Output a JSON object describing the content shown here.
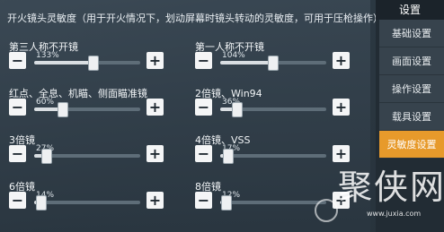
{
  "header": {
    "text": "开火镜头灵敏度（用于开火情况下，划动屏幕时镜头转动的灵敏度，可用于压枪操作）"
  },
  "settings": [
    {
      "label": "第三人称不开镜",
      "percent": "133%",
      "fraction": 0.55
    },
    {
      "label": "第一人称不开镜",
      "percent": "104%",
      "fraction": 0.49
    },
    {
      "label": "红点、全息、机瞄、侧面瞄准镜",
      "percent": "60%",
      "fraction": 0.26
    },
    {
      "label": "2倍镜、Win94",
      "percent": "36%",
      "fraction": 0.15
    },
    {
      "label": "3倍镜",
      "percent": "27%",
      "fraction": 0.11
    },
    {
      "label": "4倍镜、VSS",
      "percent": "17%",
      "fraction": 0.07
    },
    {
      "label": "6倍镜",
      "percent": "14%",
      "fraction": 0.06
    },
    {
      "label": "8倍镜",
      "percent": "12%",
      "fraction": 0.05
    }
  ],
  "buttons": {
    "minus": "−",
    "plus": "+"
  },
  "sidebar": {
    "title": "设置",
    "items": [
      {
        "label": "基础设置"
      },
      {
        "label": "画面设置"
      },
      {
        "label": "操作设置"
      },
      {
        "label": "载具设置"
      },
      {
        "label": "灵敏度设置",
        "active": true
      }
    ]
  },
  "watermark": {
    "text": "聚侠网",
    "url": "www.juxia.com"
  },
  "colors": {
    "accent": "#e79a2b",
    "sidebar_bg": "#222c34",
    "button_bg": "#f4f5f6"
  }
}
